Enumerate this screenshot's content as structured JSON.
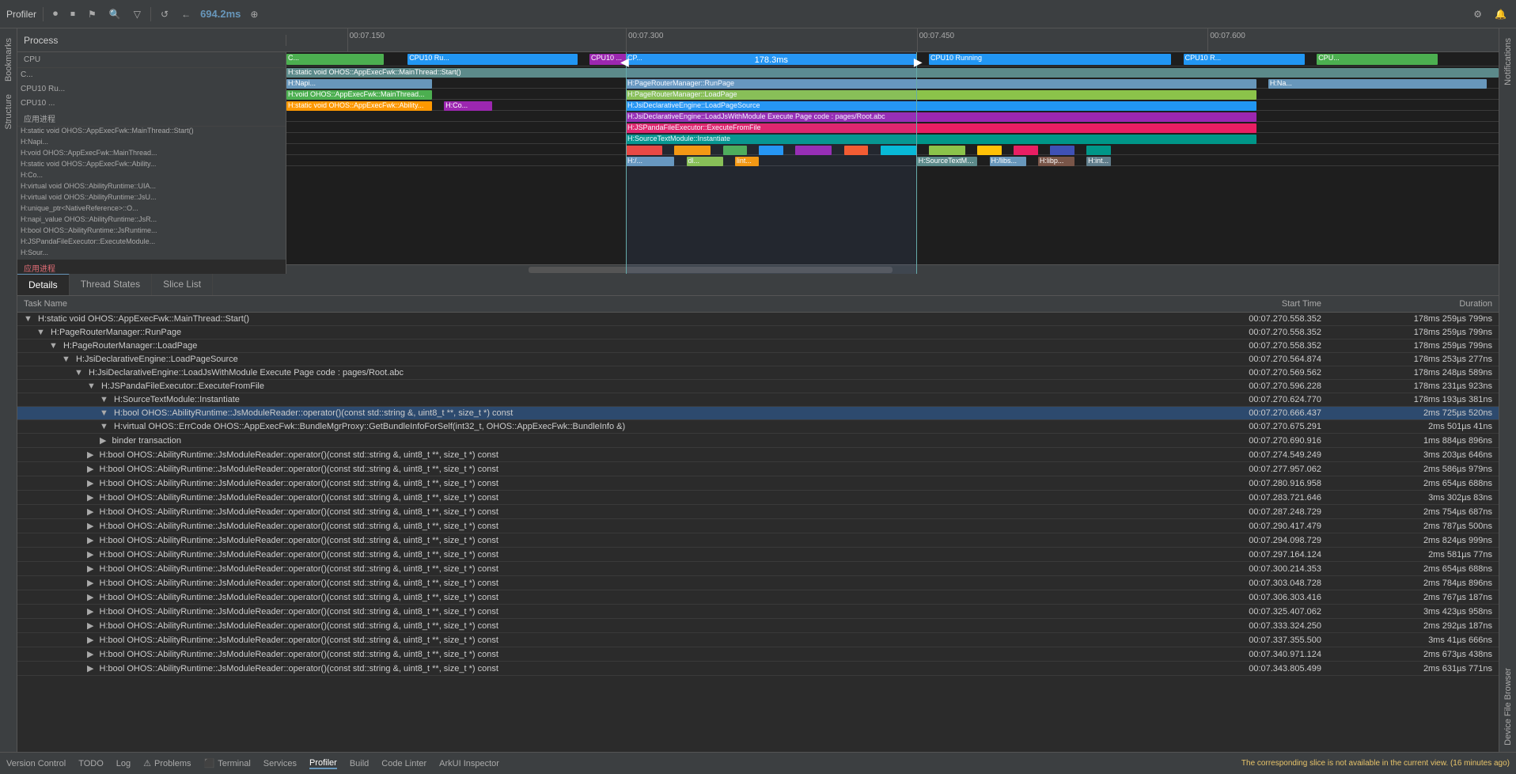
{
  "toolbar": {
    "title": "Profiler",
    "buttons": [
      "record",
      "stop",
      "markers",
      "search",
      "filter"
    ],
    "duration": "694.2ms",
    "settings_label": "⚙",
    "notifications_label": "🔔"
  },
  "timeline": {
    "process_label": "Process",
    "app_label": "应用进程",
    "time_labels": [
      "00:07.150",
      "00:07.300",
      "00:07.450",
      "00:07.600"
    ],
    "selection_width_label": "178.3ms",
    "cpu_rows": [
      {
        "label": "C...",
        "color": "#4caf50"
      },
      {
        "label": "CPU10 Ru...",
        "color": "#2196f3"
      },
      {
        "label": "CPU10 ...",
        "color": "#9c27b0"
      }
    ],
    "function_rows": [
      {
        "label": "H:static void OHOS::AppExecFwk::MainThread::Start()",
        "color": "#5c8a8a"
      },
      {
        "label": "H:...",
        "color": "#6897bb"
      },
      {
        "label": "H:void OHOS::AppExecFwk::MainThread...",
        "color": "#4caf50"
      },
      {
        "label": "H:static void OHOS::AppExecFwk::Ability...",
        "color": "#ff9800"
      },
      {
        "label": "H:Co...",
        "color": "#9c27b0"
      },
      {
        "label": "H:virtual void OHOS::AbilityRuntime::UIA...",
        "color": "#2196f3"
      },
      {
        "label": "H:virtual void OHOS::AbilityRuntime::JsU...",
        "color": "#e91e63"
      },
      {
        "label": "H:unique_ptr<NativeReference>::O...",
        "color": "#009688"
      },
      {
        "label": "H:napi_value OHOS::AbilityRuntime::JsR...",
        "color": "#ff5722"
      },
      {
        "label": "H:bool OHOS::AbilityRuntime::JsRuntime...",
        "color": "#8bc34a"
      },
      {
        "label": "H:JSPandaFileExecutor::ExecuteModule...",
        "color": "#00bcd4"
      },
      {
        "label": "H:Sour...",
        "color": "#3f51b5"
      }
    ]
  },
  "tabs": {
    "items": [
      "Details",
      "Thread States",
      "Slice List"
    ],
    "active": "Details"
  },
  "table": {
    "columns": [
      "Task Name",
      "Start Time",
      "Duration"
    ],
    "rows": [
      {
        "indent": 0,
        "expanded": true,
        "name": "H:static void OHOS::AppExecFwk::MainThread::Start()",
        "start": "00:07.270.558.352",
        "duration": "178ms 259µs 799ns"
      },
      {
        "indent": 1,
        "expanded": true,
        "name": "H:PageRouterManager::RunPage",
        "start": "00:07.270.558.352",
        "duration": "178ms 259µs 799ns"
      },
      {
        "indent": 2,
        "expanded": true,
        "name": "H:PageRouterManager::LoadPage",
        "start": "00:07.270.558.352",
        "duration": "178ms 259µs 799ns"
      },
      {
        "indent": 3,
        "expanded": true,
        "name": "H:JsiDeclarativeEngine::LoadPageSource",
        "start": "00:07.270.564.874",
        "duration": "178ms 253µs 277ns"
      },
      {
        "indent": 4,
        "expanded": true,
        "name": "H:JsiDeclarativeEngine::LoadJsWithModule Execute Page code : pages/Root.abc",
        "start": "00:07.270.569.562",
        "duration": "178ms 248µs 589ns"
      },
      {
        "indent": 5,
        "expanded": true,
        "name": "H:JSPandaFileExecutor::ExecuteFromFile",
        "start": "00:07.270.596.228",
        "duration": "178ms 231µs 923ns"
      },
      {
        "indent": 6,
        "expanded": true,
        "name": "H:SourceTextModule::Instantiate",
        "start": "00:07.270.624.770",
        "duration": "178ms 193µs 381ns"
      },
      {
        "indent": 6,
        "expanded": true,
        "selected": true,
        "name": "H:bool OHOS::AbilityRuntime::JsModuleReader::operator()(const std::string &, uint8_t **, size_t *) const",
        "start": "00:07.270.666.437",
        "duration": "2ms 725µs 520ns"
      },
      {
        "indent": 6,
        "expanded": true,
        "name": "H:virtual OHOS::ErrCode OHOS::AppExecFwk::BundleMgrProxy::GetBundleInfoForSelf(int32_t, OHOS::AppExecFwk::BundleInfo &)",
        "start": "00:07.270.675.291",
        "duration": "2ms 501µs 41ns"
      },
      {
        "indent": 6,
        "expanded": false,
        "name": "binder transaction",
        "start": "00:07.270.690.916",
        "duration": "1ms 884µs 896ns"
      },
      {
        "indent": 5,
        "expanded": false,
        "name": "H:bool OHOS::AbilityRuntime::JsModuleReader::operator()(const std::string &, uint8_t **, size_t *) const",
        "start": "00:07.274.549.249",
        "duration": "3ms 203µs 646ns"
      },
      {
        "indent": 5,
        "expanded": false,
        "name": "H:bool OHOS::AbilityRuntime::JsModuleReader::operator()(const std::string &, uint8_t **, size_t *) const",
        "start": "00:07.277.957.062",
        "duration": "2ms 586µs 979ns"
      },
      {
        "indent": 5,
        "expanded": false,
        "name": "H:bool OHOS::AbilityRuntime::JsModuleReader::operator()(const std::string &, uint8_t **, size_t *) const",
        "start": "00:07.280.916.958",
        "duration": "2ms 654µs 688ns"
      },
      {
        "indent": 5,
        "expanded": false,
        "name": "H:bool OHOS::AbilityRuntime::JsModuleReader::operator()(const std::string &, uint8_t **, size_t *) const",
        "start": "00:07.283.721.646",
        "duration": "3ms 302µs 83ns"
      },
      {
        "indent": 5,
        "expanded": false,
        "name": "H:bool OHOS::AbilityRuntime::JsModuleReader::operator()(const std::string &, uint8_t **, size_t *) const",
        "start": "00:07.287.248.729",
        "duration": "2ms 754µs 687ns"
      },
      {
        "indent": 5,
        "expanded": false,
        "name": "H:bool OHOS::AbilityRuntime::JsModuleReader::operator()(const std::string &, uint8_t **, size_t *) const",
        "start": "00:07.290.417.479",
        "duration": "2ms 787µs 500ns"
      },
      {
        "indent": 5,
        "expanded": false,
        "name": "H:bool OHOS::AbilityRuntime::JsModuleReader::operator()(const std::string &, uint8_t **, size_t *) const",
        "start": "00:07.294.098.729",
        "duration": "2ms 824µs 999ns"
      },
      {
        "indent": 5,
        "expanded": false,
        "name": "H:bool OHOS::AbilityRuntime::JsModuleReader::operator()(const std::string &, uint8_t **, size_t *) const",
        "start": "00:07.297.164.124",
        "duration": "2ms 581µs 77ns"
      },
      {
        "indent": 5,
        "expanded": false,
        "name": "H:bool OHOS::AbilityRuntime::JsModuleReader::operator()(const std::string &, uint8_t **, size_t *) const",
        "start": "00:07.300.214.353",
        "duration": "2ms 654µs 688ns"
      },
      {
        "indent": 5,
        "expanded": false,
        "name": "H:bool OHOS::AbilityRuntime::JsModuleReader::operator()(const std::string &, uint8_t **, size_t *) const",
        "start": "00:07.303.048.728",
        "duration": "2ms 784µs 896ns"
      },
      {
        "indent": 5,
        "expanded": false,
        "name": "H:bool OHOS::AbilityRuntime::JsModuleReader::operator()(const std::string &, uint8_t **, size_t *) const",
        "start": "00:07.306.303.416",
        "duration": "2ms 767µs 187ns"
      },
      {
        "indent": 5,
        "expanded": false,
        "name": "H:bool OHOS::AbilityRuntime::JsModuleReader::operator()(const std::string &, uint8_t **, size_t *) const",
        "start": "00:07.325.407.062",
        "duration": "3ms 423µs 958ns"
      },
      {
        "indent": 5,
        "expanded": false,
        "name": "H:bool OHOS::AbilityRuntime::JsModuleReader::operator()(const std::string &, uint8_t **, size_t *) const",
        "start": "00:07.333.324.250",
        "duration": "2ms 292µs 187ns"
      },
      {
        "indent": 5,
        "expanded": false,
        "name": "H:bool OHOS::AbilityRuntime::JsModuleReader::operator()(const std::string &, uint8_t **, size_t *) const",
        "start": "00:07.337.355.500",
        "duration": "3ms 41µs 666ns"
      },
      {
        "indent": 5,
        "expanded": false,
        "name": "H:bool OHOS::AbilityRuntime::JsModuleReader::operator()(const std::string &, uint8_t **, size_t *) const",
        "start": "00:07.340.971.124",
        "duration": "2ms 673µs 438ns"
      },
      {
        "indent": 5,
        "expanded": false,
        "name": "H:bool OHOS::AbilityRuntime::JsModuleReader::operator()(const std::string &, uint8_t **, size_t *) const",
        "start": "00:07.343.805.499",
        "duration": "2ms 631µs 771ns"
      }
    ]
  },
  "status_bar": {
    "items": [
      "Version Control",
      "TODO",
      "Log",
      "Problems",
      "Terminal",
      "Services",
      "Profiler",
      "Build",
      "Code Linter",
      "ArkUI Inspector"
    ],
    "active": "Profiler",
    "warning": "The corresponding slice is not available in the current view. (16 minutes ago)"
  },
  "thread_states_label": "Thread States",
  "right_sidebar": {
    "notifications": "Notifications",
    "device_file": "Device File Browser"
  }
}
